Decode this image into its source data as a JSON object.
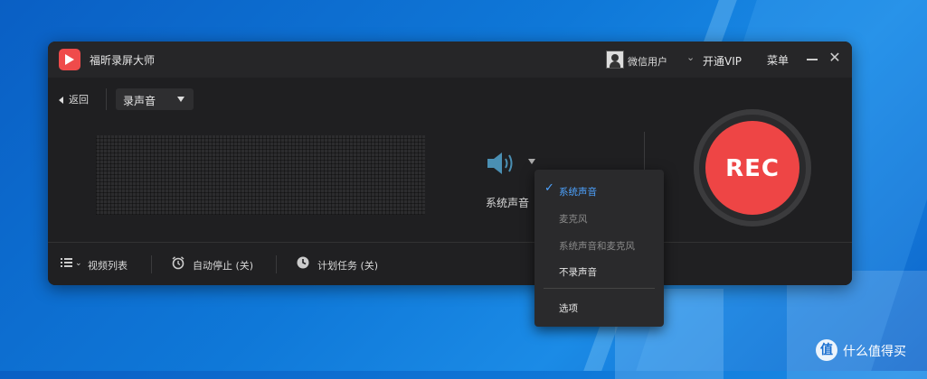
{
  "app": {
    "title": "福昕录屏大师",
    "user_name": "微信用户",
    "vip_label": "开通VIP",
    "menu_label": "菜单",
    "close_glyph": "✕"
  },
  "toolbar": {
    "back_label": "返回",
    "mode_label": "录声音"
  },
  "audio": {
    "source_label": "系统声音"
  },
  "rec": {
    "label": "REC",
    "color": "#ee4545"
  },
  "bottom": {
    "video_list": "视频列表",
    "auto_stop": "自动停止 (关)",
    "scheduled": "计划任务 (关)"
  },
  "dropdown": {
    "items": [
      {
        "label": "系统声音",
        "selected": true
      },
      {
        "label": "麦克风",
        "selected": false
      },
      {
        "label": "系统声音和麦克风",
        "selected": false
      },
      {
        "label": "不录声音",
        "selected": false
      }
    ],
    "options_label": "选项",
    "check_glyph": "✓"
  },
  "watermark": {
    "glyph": "值",
    "text": "什么值得买"
  },
  "colors": {
    "accent": "#4da3ff",
    "window_bg": "#1f1f21",
    "rec_red": "#ee4545",
    "app_logo": "#ef4b4b"
  }
}
